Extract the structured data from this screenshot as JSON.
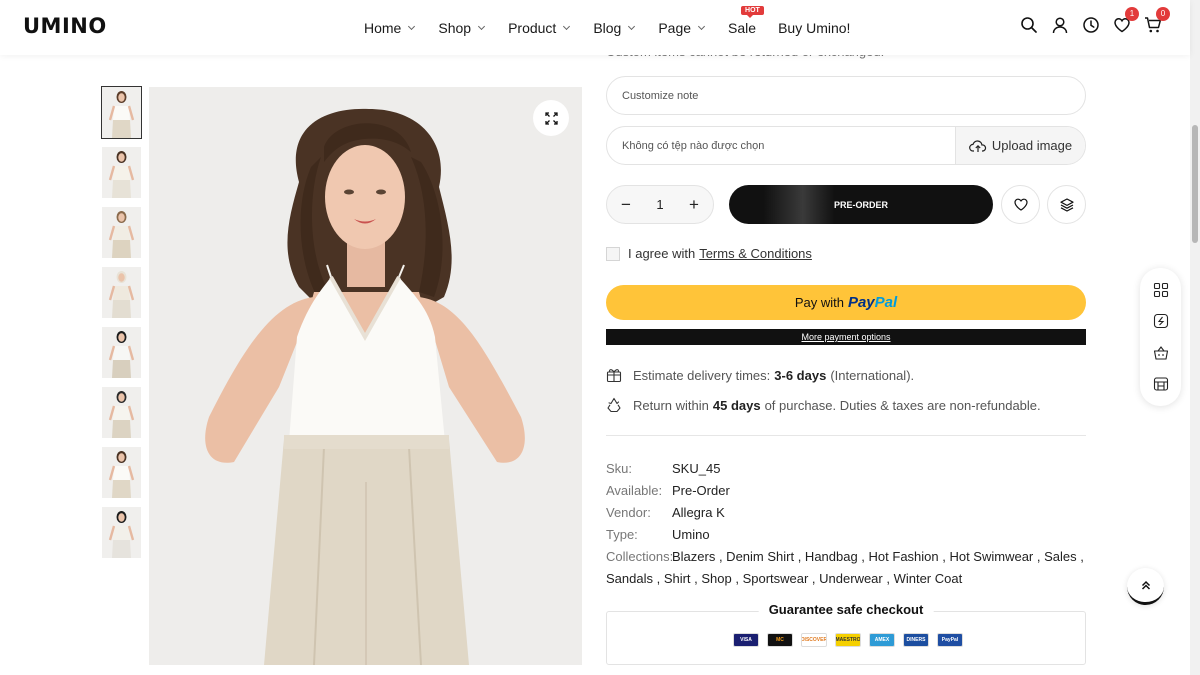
{
  "header": {
    "logo": "UMINO",
    "nav": [
      {
        "label": "Home",
        "has_dropdown": true
      },
      {
        "label": "Shop",
        "has_dropdown": true
      },
      {
        "label": "Product",
        "has_dropdown": true
      },
      {
        "label": "Blog",
        "has_dropdown": true
      },
      {
        "label": "Page",
        "has_dropdown": true
      },
      {
        "label": "Sale",
        "has_dropdown": false,
        "badge": "HOT"
      },
      {
        "label": "Buy Umino!",
        "has_dropdown": false
      }
    ],
    "icons": [
      "search-icon",
      "account-icon",
      "history-icon",
      "wishlist-icon",
      "cart-icon"
    ],
    "wishlist_count": "1",
    "cart_count": "0"
  },
  "gallery": {
    "thumbnail_count": 8,
    "active_thumbnail": 1
  },
  "form": {
    "cut_text": "Custom items cannot be returned or exchanged.",
    "note_placeholder": "Customize note",
    "file_text": "Không có tệp nào được chọn",
    "upload_label": "Upload image",
    "quantity": "1",
    "minus": "−",
    "plus": "+",
    "preorder_label": "PRE-ORDER",
    "agree_text": "I agree with",
    "terms_label": "Terms & Conditions",
    "paypal_prefix": "Pay with",
    "paypal_brand_a": "Pay",
    "paypal_brand_b": "Pal",
    "more_payment": "More payment options"
  },
  "delivery": {
    "estimate_prefix": "Estimate delivery times:",
    "estimate_days": "3-6 days",
    "estimate_suffix": "(International).",
    "return_prefix": "Return within",
    "return_days": "45 days",
    "return_suffix": "of purchase. Duties & taxes are non-refundable."
  },
  "meta": [
    {
      "label": "Sku:",
      "value": "SKU_45"
    },
    {
      "label": "Available:",
      "value": "Pre-Order"
    },
    {
      "label": "Vendor:",
      "value": "Allegra K"
    },
    {
      "label": "Type:",
      "value": "Umino"
    },
    {
      "label": "Collections:",
      "value": "Blazers , Denim Shirt , Handbag , Hot Fashion , Hot Swimwear , Sales ,"
    },
    {
      "label": "",
      "value": "Sandals , Shirt , Shop , Sportswear , Underwear , Winter Coat"
    }
  ],
  "guarantee": {
    "title": "Guarantee safe checkout",
    "cards": [
      {
        "name": "VISA",
        "bg": "#1a1f71",
        "fg": "#ffffff"
      },
      {
        "name": "MC",
        "bg": "#111111",
        "fg": "#f79e1b"
      },
      {
        "name": "DISCOVER",
        "bg": "#ffffff",
        "fg": "#e07a1f"
      },
      {
        "name": "MAESTRO",
        "bg": "#f5d000",
        "fg": "#333333"
      },
      {
        "name": "AMEX",
        "bg": "#2e9bd6",
        "fg": "#ffffff"
      },
      {
        "name": "DINERS",
        "bg": "#1c4ea0",
        "fg": "#ffffff"
      },
      {
        "name": "PayPal",
        "bg": "#1f4ea3",
        "fg": "#ffffff"
      }
    ]
  },
  "colors": {
    "accent": "#111111",
    "badge": "#e23b3b",
    "paypal": "#ffc439"
  }
}
